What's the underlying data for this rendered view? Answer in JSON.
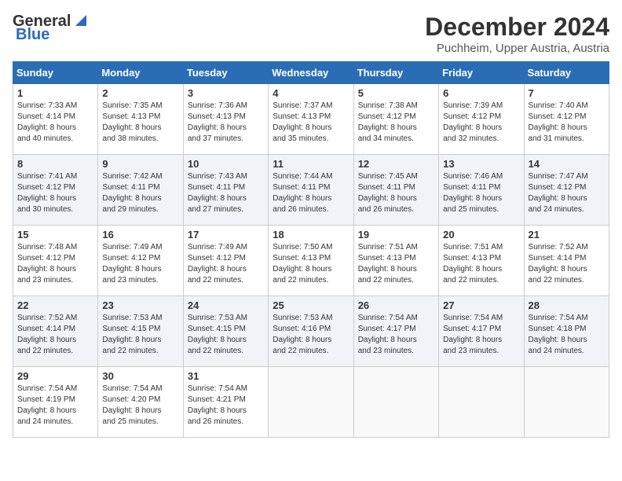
{
  "header": {
    "logo_line1": "General",
    "logo_line2": "Blue",
    "month": "December 2024",
    "location": "Puchheim, Upper Austria, Austria"
  },
  "weekdays": [
    "Sunday",
    "Monday",
    "Tuesday",
    "Wednesday",
    "Thursday",
    "Friday",
    "Saturday"
  ],
  "weeks": [
    [
      {
        "day": "1",
        "sunrise": "7:33 AM",
        "sunset": "4:14 PM",
        "daylight": "8 hours and 40 minutes."
      },
      {
        "day": "2",
        "sunrise": "7:35 AM",
        "sunset": "4:13 PM",
        "daylight": "8 hours and 38 minutes."
      },
      {
        "day": "3",
        "sunrise": "7:36 AM",
        "sunset": "4:13 PM",
        "daylight": "8 hours and 37 minutes."
      },
      {
        "day": "4",
        "sunrise": "7:37 AM",
        "sunset": "4:13 PM",
        "daylight": "8 hours and 35 minutes."
      },
      {
        "day": "5",
        "sunrise": "7:38 AM",
        "sunset": "4:12 PM",
        "daylight": "8 hours and 34 minutes."
      },
      {
        "day": "6",
        "sunrise": "7:39 AM",
        "sunset": "4:12 PM",
        "daylight": "8 hours and 32 minutes."
      },
      {
        "day": "7",
        "sunrise": "7:40 AM",
        "sunset": "4:12 PM",
        "daylight": "8 hours and 31 minutes."
      }
    ],
    [
      {
        "day": "8",
        "sunrise": "7:41 AM",
        "sunset": "4:12 PM",
        "daylight": "8 hours and 30 minutes."
      },
      {
        "day": "9",
        "sunrise": "7:42 AM",
        "sunset": "4:11 PM",
        "daylight": "8 hours and 29 minutes."
      },
      {
        "day": "10",
        "sunrise": "7:43 AM",
        "sunset": "4:11 PM",
        "daylight": "8 hours and 27 minutes."
      },
      {
        "day": "11",
        "sunrise": "7:44 AM",
        "sunset": "4:11 PM",
        "daylight": "8 hours and 26 minutes."
      },
      {
        "day": "12",
        "sunrise": "7:45 AM",
        "sunset": "4:11 PM",
        "daylight": "8 hours and 26 minutes."
      },
      {
        "day": "13",
        "sunrise": "7:46 AM",
        "sunset": "4:11 PM",
        "daylight": "8 hours and 25 minutes."
      },
      {
        "day": "14",
        "sunrise": "7:47 AM",
        "sunset": "4:12 PM",
        "daylight": "8 hours and 24 minutes."
      }
    ],
    [
      {
        "day": "15",
        "sunrise": "7:48 AM",
        "sunset": "4:12 PM",
        "daylight": "8 hours and 23 minutes."
      },
      {
        "day": "16",
        "sunrise": "7:49 AM",
        "sunset": "4:12 PM",
        "daylight": "8 hours and 23 minutes."
      },
      {
        "day": "17",
        "sunrise": "7:49 AM",
        "sunset": "4:12 PM",
        "daylight": "8 hours and 22 minutes."
      },
      {
        "day": "18",
        "sunrise": "7:50 AM",
        "sunset": "4:13 PM",
        "daylight": "8 hours and 22 minutes."
      },
      {
        "day": "19",
        "sunrise": "7:51 AM",
        "sunset": "4:13 PM",
        "daylight": "8 hours and 22 minutes."
      },
      {
        "day": "20",
        "sunrise": "7:51 AM",
        "sunset": "4:13 PM",
        "daylight": "8 hours and 22 minutes."
      },
      {
        "day": "21",
        "sunrise": "7:52 AM",
        "sunset": "4:14 PM",
        "daylight": "8 hours and 22 minutes."
      }
    ],
    [
      {
        "day": "22",
        "sunrise": "7:52 AM",
        "sunset": "4:14 PM",
        "daylight": "8 hours and 22 minutes."
      },
      {
        "day": "23",
        "sunrise": "7:53 AM",
        "sunset": "4:15 PM",
        "daylight": "8 hours and 22 minutes."
      },
      {
        "day": "24",
        "sunrise": "7:53 AM",
        "sunset": "4:15 PM",
        "daylight": "8 hours and 22 minutes."
      },
      {
        "day": "25",
        "sunrise": "7:53 AM",
        "sunset": "4:16 PM",
        "daylight": "8 hours and 22 minutes."
      },
      {
        "day": "26",
        "sunrise": "7:54 AM",
        "sunset": "4:17 PM",
        "daylight": "8 hours and 23 minutes."
      },
      {
        "day": "27",
        "sunrise": "7:54 AM",
        "sunset": "4:17 PM",
        "daylight": "8 hours and 23 minutes."
      },
      {
        "day": "28",
        "sunrise": "7:54 AM",
        "sunset": "4:18 PM",
        "daylight": "8 hours and 24 minutes."
      }
    ],
    [
      {
        "day": "29",
        "sunrise": "7:54 AM",
        "sunset": "4:19 PM",
        "daylight": "8 hours and 24 minutes."
      },
      {
        "day": "30",
        "sunrise": "7:54 AM",
        "sunset": "4:20 PM",
        "daylight": "8 hours and 25 minutes."
      },
      {
        "day": "31",
        "sunrise": "7:54 AM",
        "sunset": "4:21 PM",
        "daylight": "8 hours and 26 minutes."
      },
      null,
      null,
      null,
      null
    ]
  ],
  "labels": {
    "sunrise": "Sunrise:",
    "sunset": "Sunset:",
    "daylight": "Daylight:"
  }
}
